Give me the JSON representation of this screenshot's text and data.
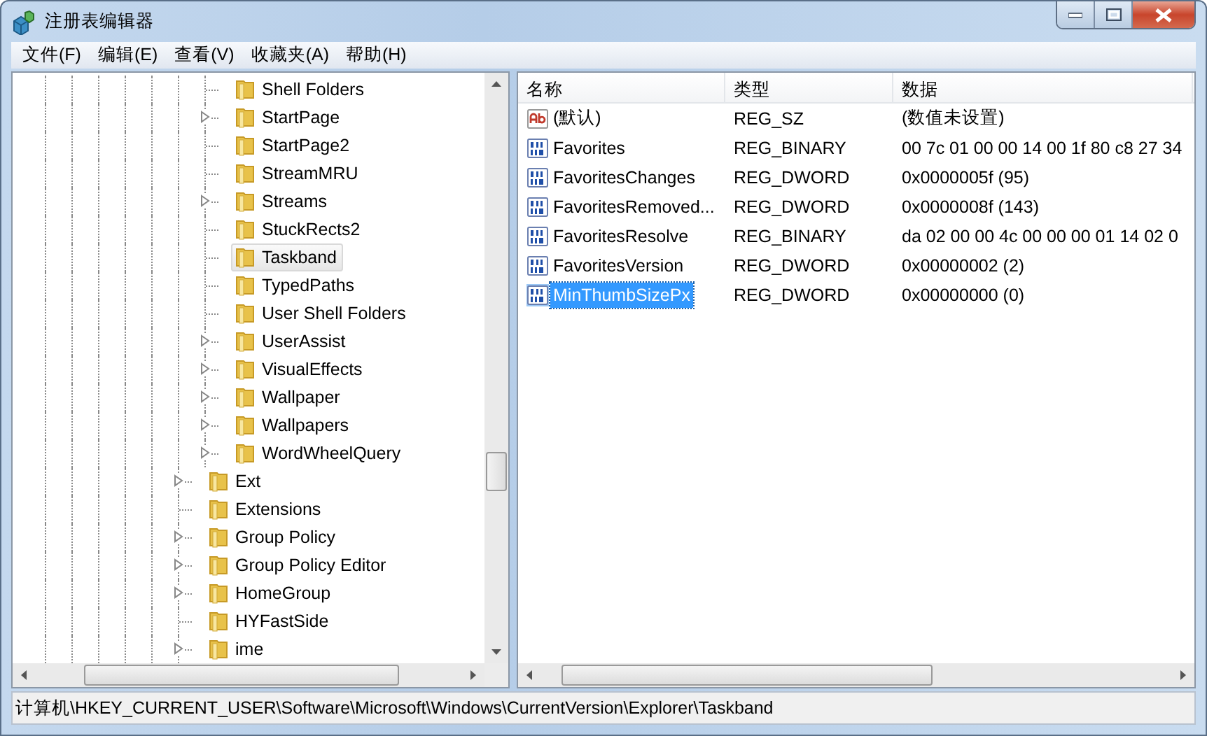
{
  "window": {
    "title": "注册表编辑器"
  },
  "menu": [
    "文件(F)",
    "编辑(E)",
    "查看(V)",
    "收藏夹(A)",
    "帮助(H)"
  ],
  "tree": {
    "items": [
      {
        "children": [
          {
            "label": "Shell Folders",
            "expandable": false,
            "selected": false
          },
          {
            "label": "StartPage",
            "expandable": true,
            "selected": false
          },
          {
            "label": "StartPage2",
            "expandable": false,
            "selected": false
          },
          {
            "label": "StreamMRU",
            "expandable": false,
            "selected": false
          },
          {
            "label": "Streams",
            "expandable": true,
            "selected": false
          },
          {
            "label": "StuckRects2",
            "expandable": false,
            "selected": false
          },
          {
            "label": "Taskband",
            "expandable": false,
            "selected": true
          },
          {
            "label": "TypedPaths",
            "expandable": false,
            "selected": false
          },
          {
            "label": "User Shell Folders",
            "expandable": false,
            "selected": false
          },
          {
            "label": "UserAssist",
            "expandable": true,
            "selected": false
          },
          {
            "label": "VisualEffects",
            "expandable": true,
            "selected": false
          },
          {
            "label": "Wallpaper",
            "expandable": true,
            "selected": false
          },
          {
            "label": "Wallpapers",
            "expandable": true,
            "selected": false
          },
          {
            "label": "WordWheelQuery",
            "expandable": true,
            "selected": false
          }
        ]
      },
      {
        "label": "Ext",
        "expandable": true,
        "selected": false
      },
      {
        "label": "Extensions",
        "expandable": false,
        "selected": false
      },
      {
        "label": "Group Policy",
        "expandable": true,
        "selected": false
      },
      {
        "label": "Group Policy Editor",
        "expandable": true,
        "selected": false
      },
      {
        "label": "HomeGroup",
        "expandable": true,
        "selected": false
      },
      {
        "label": "HYFastSide",
        "expandable": false,
        "selected": false
      },
      {
        "label": "ime",
        "expandable": true,
        "selected": false
      }
    ]
  },
  "values": {
    "columns": [
      "名称",
      "类型",
      "数据"
    ],
    "rows": [
      {
        "kind": "string",
        "name": "(默认)",
        "type": "REG_SZ",
        "data": "(数值未设置)",
        "selected": false
      },
      {
        "kind": "binary",
        "name": "Favorites",
        "type": "REG_BINARY",
        "data": "00 7c 01 00 00 14 00 1f 80 c8 27 34",
        "selected": false
      },
      {
        "kind": "binary",
        "name": "FavoritesChanges",
        "type": "REG_DWORD",
        "data": "0x0000005f (95)",
        "selected": false
      },
      {
        "kind": "binary",
        "name": "FavoritesRemoved...",
        "type": "REG_DWORD",
        "data": "0x0000008f (143)",
        "selected": false
      },
      {
        "kind": "binary",
        "name": "FavoritesResolve",
        "type": "REG_BINARY",
        "data": "da 02 00 00 4c 00 00 00 01 14 02 0",
        "selected": false
      },
      {
        "kind": "binary",
        "name": "FavoritesVersion",
        "type": "REG_DWORD",
        "data": "0x00000002 (2)",
        "selected": false
      },
      {
        "kind": "binary",
        "name": "MinThumbSizePx",
        "type": "REG_DWORD",
        "data": "0x00000000 (0)",
        "selected": true
      }
    ]
  },
  "status_bar": "计算机\\HKEY_CURRENT_USER\\Software\\Microsoft\\Windows\\CurrentVersion\\Explorer\\Taskband"
}
